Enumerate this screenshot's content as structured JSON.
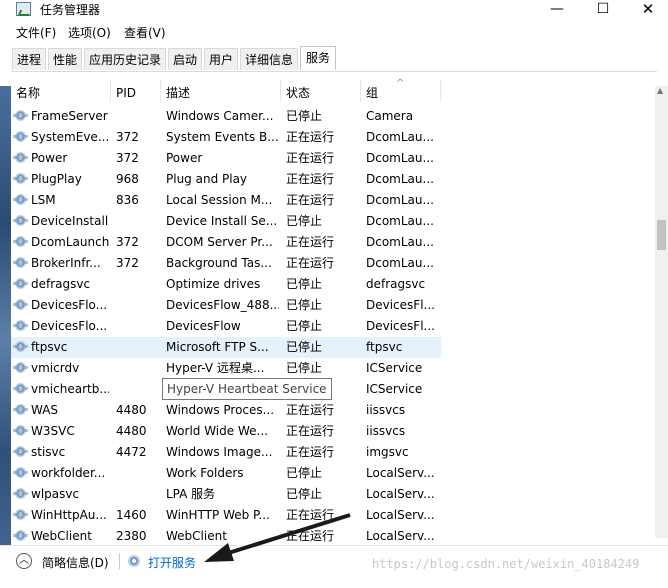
{
  "window": {
    "title": "任务管理器",
    "minimize_label": "—",
    "maximize_label": "☐",
    "close_label": "✕"
  },
  "menu": [
    "文件(F)",
    "选项(O)",
    "查看(V)"
  ],
  "tabs": [
    "进程",
    "性能",
    "应用历史记录",
    "启动",
    "用户",
    "详细信息",
    "服务"
  ],
  "active_tab": "服务",
  "columns": {
    "name": "名称",
    "pid": "PID",
    "desc": "描述",
    "state": "状态",
    "group": "组",
    "sort_arrow": "^"
  },
  "rows": [
    {
      "name": "FrameServer",
      "pid": "",
      "desc": "Windows Camer...",
      "state": "已停止",
      "group": "Camera"
    },
    {
      "name": "SystemEve...",
      "pid": "372",
      "desc": "System Events B...",
      "state": "正在运行",
      "group": "DcomLau..."
    },
    {
      "name": "Power",
      "pid": "372",
      "desc": "Power",
      "state": "正在运行",
      "group": "DcomLau..."
    },
    {
      "name": "PlugPlay",
      "pid": "968",
      "desc": "Plug and Play",
      "state": "正在运行",
      "group": "DcomLau..."
    },
    {
      "name": "LSM",
      "pid": "836",
      "desc": "Local Session M...",
      "state": "正在运行",
      "group": "DcomLau..."
    },
    {
      "name": "DeviceInstall",
      "pid": "",
      "desc": "Device Install Se...",
      "state": "已停止",
      "group": "DcomLau..."
    },
    {
      "name": "DcomLaunch",
      "pid": "372",
      "desc": "DCOM Server Pr...",
      "state": "正在运行",
      "group": "DcomLau..."
    },
    {
      "name": "BrokerInfr...",
      "pid": "372",
      "desc": "Background Tas...",
      "state": "正在运行",
      "group": "DcomLau..."
    },
    {
      "name": "defragsvc",
      "pid": "",
      "desc": "Optimize drives",
      "state": "已停止",
      "group": "defragsvc"
    },
    {
      "name": "DevicesFlo...",
      "pid": "",
      "desc": "DevicesFlow_488...",
      "state": "已停止",
      "group": "DevicesFl..."
    },
    {
      "name": "DevicesFlo...",
      "pid": "",
      "desc": "DevicesFlow",
      "state": "已停止",
      "group": "DevicesFl..."
    },
    {
      "name": "ftpsvc",
      "pid": "",
      "desc": "Microsoft FTP S...",
      "state": "已停止",
      "group": "ftpsvc",
      "selected": true
    },
    {
      "name": "vmicrdv",
      "pid": "",
      "desc": "Hyper-V 远程桌...",
      "state": "已停止",
      "group": "ICService"
    },
    {
      "name": "vmicheartb...",
      "pid": "",
      "desc": "",
      "state": "",
      "group": "ICService"
    },
    {
      "name": "WAS",
      "pid": "4480",
      "desc": "Windows Proces...",
      "state": "正在运行",
      "group": "iissvcs"
    },
    {
      "name": "W3SVC",
      "pid": "4480",
      "desc": "World Wide We...",
      "state": "正在运行",
      "group": "iissvcs"
    },
    {
      "name": "stisvc",
      "pid": "4472",
      "desc": "Windows Image...",
      "state": "正在运行",
      "group": "imgsvc"
    },
    {
      "name": "workfolder...",
      "pid": "",
      "desc": "Work Folders",
      "state": "已停止",
      "group": "LocalServ..."
    },
    {
      "name": "wlpasvc",
      "pid": "",
      "desc": "LPA 服务",
      "state": "已停止",
      "group": "LocalServ..."
    },
    {
      "name": "WinHttpAu...",
      "pid": "1460",
      "desc": "WinHTTP Web P...",
      "state": "正在运行",
      "group": "LocalServ..."
    },
    {
      "name": "WebClient",
      "pid": "2380",
      "desc": "WebClient",
      "state": "正在运行",
      "group": "LocalServ..."
    }
  ],
  "tooltip": "Hyper-V Heartbeat Service",
  "footer": {
    "collapse_icon": "︿",
    "fewer_details": "简略信息(D)",
    "open_services": "打开服务"
  },
  "watermark": "https://blog.csdn.net/weixin_40184249",
  "colors": {
    "accent_link": "#0066cc",
    "selected_row": "#e5f1fb",
    "annotation_arrow": "#1a1a1a"
  }
}
